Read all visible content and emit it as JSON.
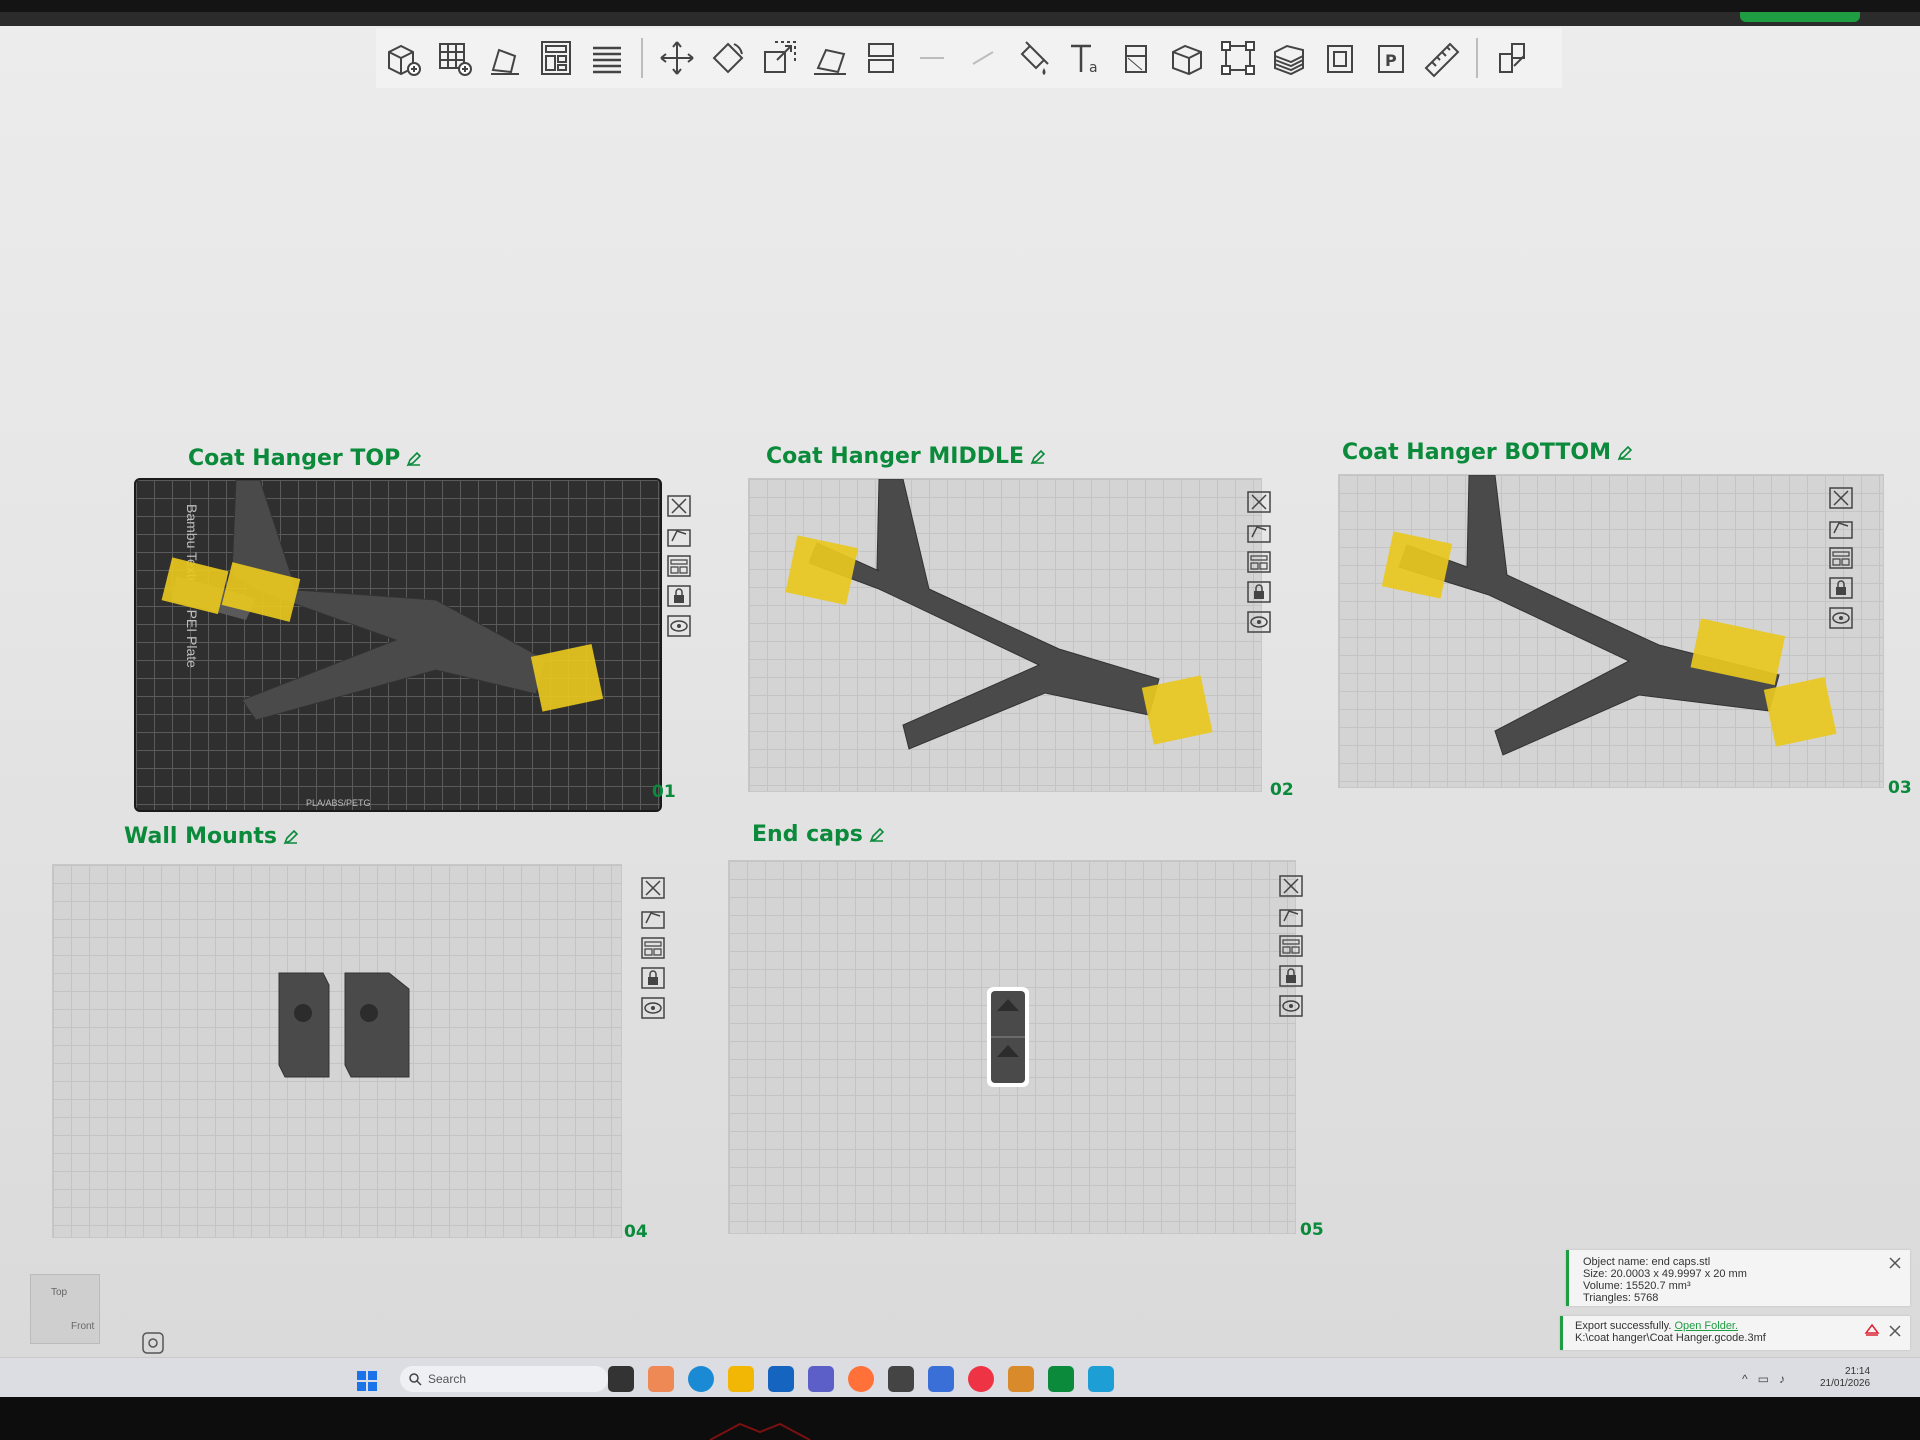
{
  "toolbar": {
    "items": [
      "add-cube",
      "add-plate",
      "auto-arrange",
      "layout",
      "layers",
      "move",
      "rotate",
      "scale",
      "lay-on-face",
      "split",
      "undo",
      "redo",
      "paint",
      "text",
      "cut",
      "boolean",
      "measure",
      "support",
      "seam",
      "variable-layer",
      "fuzzy",
      "assembly",
      "ruler",
      "more"
    ]
  },
  "plates": [
    {
      "title": "Coat Hanger TOP",
      "number": "01",
      "bed_label": "Bambu Textured PEI Plate",
      "bed_footer": "PLA/ABS/PETG"
    },
    {
      "title": "Coat Hanger MIDDLE",
      "number": "02"
    },
    {
      "title": "Coat Hanger BOTTOM",
      "number": "03"
    },
    {
      "title": "Wall Mounts",
      "number": "04"
    },
    {
      "title": "End caps",
      "number": "05"
    }
  ],
  "view_cube": {
    "top": "Top",
    "front": "Front"
  },
  "object_info": {
    "name": "Object name: end caps.stl",
    "size": "Size: 20.0003 x 49.9997 x 20 mm",
    "volume": "Volume: 15520.7 mm³",
    "triangles": "Triangles: 5768"
  },
  "export_notice": {
    "status": "Export successfully.",
    "link": "Open Folder.",
    "path": "K:\\coat hanger\\Coat Hanger.gcode.3mf"
  },
  "taskbar": {
    "search_placeholder": "Search",
    "time": "21:14",
    "date": "21/01/2026"
  },
  "colors": {
    "accent": "#0a8a3a",
    "model": "#4a4a4a",
    "modifier": "#e8c81e"
  }
}
